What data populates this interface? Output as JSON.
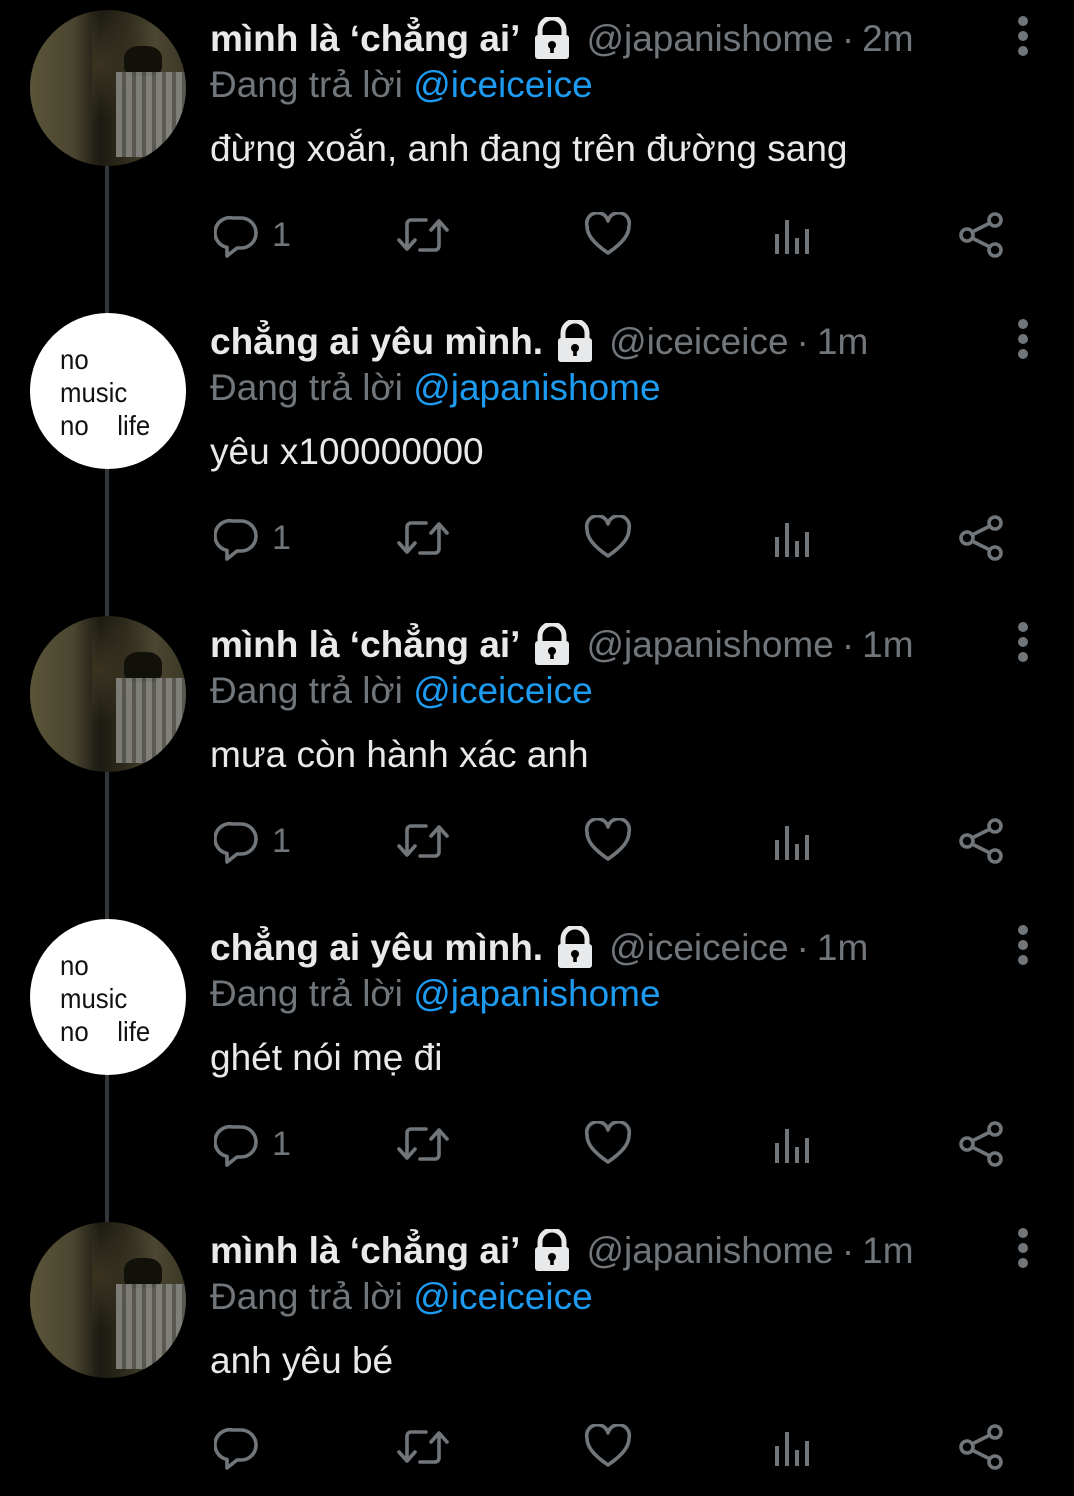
{
  "tweets": [
    {
      "display_name": "mình là ‘chẳng ai’",
      "handle": "@japanishome",
      "time": "2m",
      "reply_prefix": "Đang trả lời ",
      "reply_to": "@iceiceice",
      "text": "đừng xoắn, anh đang trên đường sang",
      "reply_count": "1",
      "avatar": "photo"
    },
    {
      "display_name": "chẳng ai yêu mình.",
      "handle": "@iceiceice",
      "time": "1m",
      "reply_prefix": "Đang trả lời ",
      "reply_to": "@japanishome",
      "text": "yêu x100000000",
      "reply_count": "1",
      "avatar": "text",
      "avatar_text": "no\nmusic\nno    life"
    },
    {
      "display_name": "mình là ‘chẳng ai’",
      "handle": "@japanishome",
      "time": "1m",
      "reply_prefix": "Đang trả lời ",
      "reply_to": "@iceiceice",
      "text": "mưa còn hành xác anh",
      "reply_count": "1",
      "avatar": "photo"
    },
    {
      "display_name": "chẳng ai yêu mình.",
      "handle": "@iceiceice",
      "time": "1m",
      "reply_prefix": "Đang trả lời ",
      "reply_to": "@japanishome",
      "text": "ghét nói mẹ đi",
      "reply_count": "1",
      "avatar": "text",
      "avatar_text": "no\nmusic\nno    life"
    },
    {
      "display_name": "mình là ‘chẳng ai’",
      "handle": "@japanishome",
      "time": "1m",
      "reply_prefix": "Đang trả lời ",
      "reply_to": "@iceiceice",
      "text": "anh yêu bé",
      "reply_count": "",
      "avatar": "photo"
    }
  ],
  "separator_dot": "·",
  "icons": {
    "lock": "lock-icon",
    "more": "more-vertical-icon",
    "reply": "reply-icon",
    "retweet": "retweet-icon",
    "like": "heart-icon",
    "views": "views-icon",
    "share": "share-icon"
  },
  "colors": {
    "background": "#000000",
    "primary_text": "#e7e9ea",
    "secondary_text": "#71767b",
    "link": "#1d9bf0",
    "thread_line": "#333639"
  }
}
